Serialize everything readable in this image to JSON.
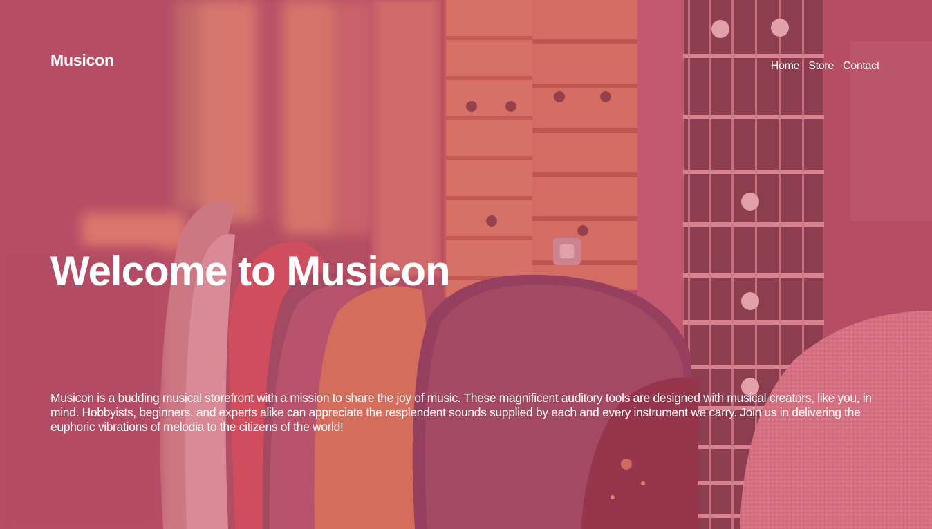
{
  "header": {
    "brand": "Musicon",
    "nav": [
      {
        "label": "Home"
      },
      {
        "label": "Store"
      },
      {
        "label": "Contact"
      }
    ]
  },
  "hero": {
    "background_image": "guitars-photo",
    "overlay_color": "#bc4860",
    "headline": "Welcome to Musicon",
    "intro": "Musicon is a budding musical storefront with a mission to share the joy of music. These magnificent auditory tools are designed with musical creators, like you, in mind. Hobbyists, beginners, and experts alike can appreciate the resplendent sounds supplied by each and every instrument we carry. Join us in delivering the euphoric vibrations of melodia to the citizens of the world!"
  }
}
